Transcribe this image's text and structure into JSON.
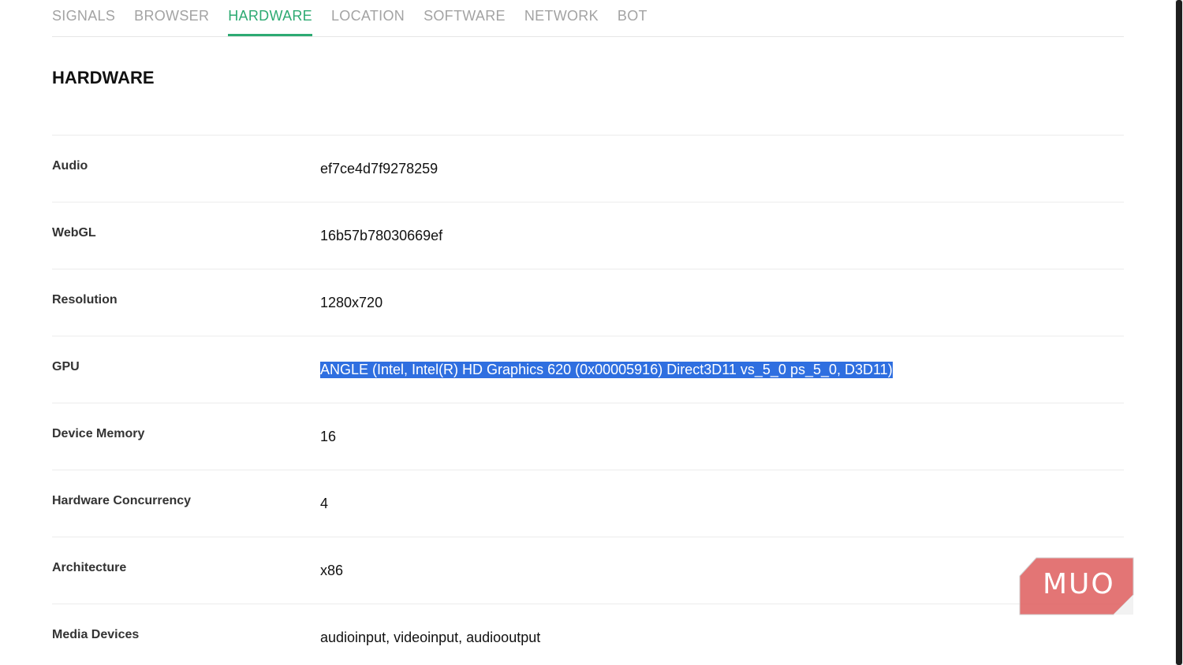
{
  "tabs": [
    {
      "label": "SIGNALS",
      "active": false
    },
    {
      "label": "BROWSER",
      "active": false
    },
    {
      "label": "HARDWARE",
      "active": true
    },
    {
      "label": "LOCATION",
      "active": false
    },
    {
      "label": "SOFTWARE",
      "active": false
    },
    {
      "label": "NETWORK",
      "active": false
    },
    {
      "label": "BOT",
      "active": false
    }
  ],
  "section": {
    "title": "HARDWARE"
  },
  "rows": [
    {
      "label": "Audio",
      "value": "ef7ce4d7f9278259"
    },
    {
      "label": "WebGL",
      "value": "16b57b78030669ef"
    },
    {
      "label": "Resolution",
      "value": "1280x720"
    },
    {
      "label": "GPU",
      "value": "ANGLE (Intel, Intel(R) HD Graphics 620 (0x00005916) Direct3D11 vs_5_0 ps_5_0, D3D11)",
      "selected": true
    },
    {
      "label": "Device Memory",
      "value": "16"
    },
    {
      "label": "Hardware Concurrency",
      "value": "4"
    },
    {
      "label": "Architecture",
      "value": "x86"
    },
    {
      "label": "Media Devices",
      "value": "audioinput, videoinput, audiooutput"
    }
  ],
  "watermark": {
    "text": "MUO"
  },
  "colors": {
    "accent": "#2daa72",
    "selection": "#2f6fe0",
    "watermark": "#e06666"
  }
}
